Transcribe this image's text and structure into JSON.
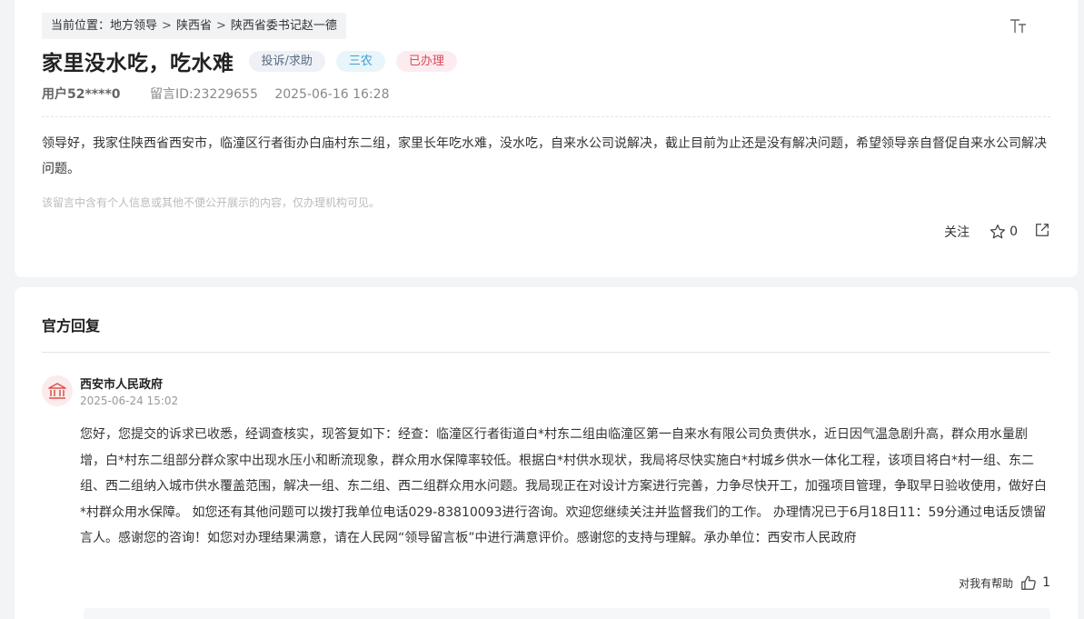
{
  "breadcrumb": {
    "prefix": "当前位置：",
    "items": [
      "地方领导",
      "陕西省",
      "陕西省委书记赵一德"
    ],
    "separator": ">"
  },
  "post": {
    "title": "家里没水吃，吃水难",
    "tags": [
      "投诉/求助",
      "三农",
      "已办理"
    ],
    "user": "用户52****0",
    "message_id": "留言ID:23229655",
    "datetime": "2025-06-16 16:28",
    "content": "领导好，我家住陕西省西安市，临潼区行者街办白庙村东二组，家里长年吃水难，没水吃，自来水公司说解决，截止目前为止还是没有解决问题，希望领导亲自督促自来水公司解决问题。",
    "privacy_notice": "该留言中含有个人信息或其他不便公开展示的内容，仅办理机构可见。",
    "follow_label": "关注",
    "star_count": "0"
  },
  "reply": {
    "section_title": "官方回复",
    "org_name": "西安市人民政府",
    "datetime": "2025-06-24 15:02",
    "body": "您好，您提交的诉求已收悉，经调查核实，现答复如下：经查：临潼区行者街道白*村东二组由临潼区第一自来水有限公司负责供水，近日因气温急剧升高，群众用水量剧增，白*村东二组部分群众家中出现水压小和断流现象，群众用水保障率较低。根据白*村供水现状，我局将尽快实施白*村城乡供水一体化工程，该项目将白*村一组、东二组、西二组纳入城市供水覆盖范围，解决一组、东二组、西二组群众用水问题。我局现正在对设计方案进行完善，力争尽快开工，加强项目管理，争取早日验收使用，做好白*村群众用水保障。 如您还有其他问题可以拨打我单位电话029-83810093进行咨询。欢迎您继续关注并监督我们的工作。 办理情况已于6月18日11：59分通过电话反馈留言人。感谢您的咨询！如您对办理结果满意，请在人民网“领导留言板”中进行满意评价。感谢您的支持与理解。承办单位：西安市人民政府",
    "helpful_label": "对我有帮助",
    "helpful_count": "1"
  },
  "icons": {
    "font_size": "font-size-icon",
    "star": "star-icon",
    "share": "share-icon",
    "government": "government-building-icon",
    "thumbs_up": "thumbs-up-icon"
  },
  "colors": {
    "tag_complaint": "#5b6b82",
    "tag_agriculture": "#3e9fcf",
    "tag_handled": "#d94a5c",
    "gov_icon": "#d9534f"
  }
}
